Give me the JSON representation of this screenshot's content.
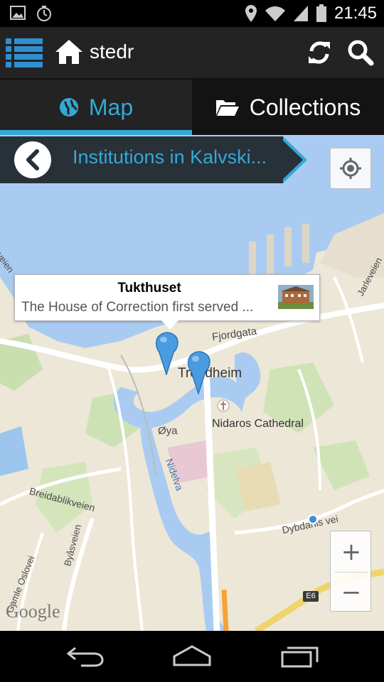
{
  "status_bar": {
    "time": "21:45",
    "left_icons": [
      "image-notification-icon",
      "clock-notification-icon"
    ],
    "right_icons": [
      "location-icon",
      "wifi-icon",
      "signal-icon",
      "battery-icon"
    ]
  },
  "action_bar": {
    "title": "stedr",
    "icons": [
      "menu-list-icon",
      "home-icon",
      "refresh-icon",
      "search-icon"
    ]
  },
  "tabs": [
    {
      "label": "Map",
      "icon": "globe-icon",
      "active": true
    },
    {
      "label": "Collections",
      "icon": "folder-icon",
      "active": false
    }
  ],
  "breadcrumb": {
    "title": "Institutions in Kalvski...",
    "back_icon": "chevron-left-icon"
  },
  "info_window": {
    "title": "Tukthuset",
    "description": "The House of Correction first served ..."
  },
  "map": {
    "labels": {
      "trondheim": "Trondheim",
      "fjordgata": "Fjordgata",
      "nidaros": "Nidaros Cathedral",
      "oya": "Øya",
      "nidelva": "Nidelva",
      "breidablikveien": "Breidablikveien",
      "byasveien": "Byåsveien",
      "gamle_oslovei": "Gamle Oslovei",
      "dybdahls": "Dybdahls vei",
      "jarleveien": "Jarleveien",
      "veien": "veien"
    },
    "route_badge": "E6",
    "zoom_in": "+",
    "zoom_out": "−",
    "attribution": "Google"
  },
  "colors": {
    "accent": "#33a9d6",
    "action_bar": "#232323",
    "breadcrumb_band": "#283038",
    "water": "#a9cbf2",
    "land": "#ede7d8"
  },
  "nav_bar": {
    "icons": [
      "back-nav-icon",
      "home-nav-icon",
      "recents-nav-icon"
    ]
  }
}
